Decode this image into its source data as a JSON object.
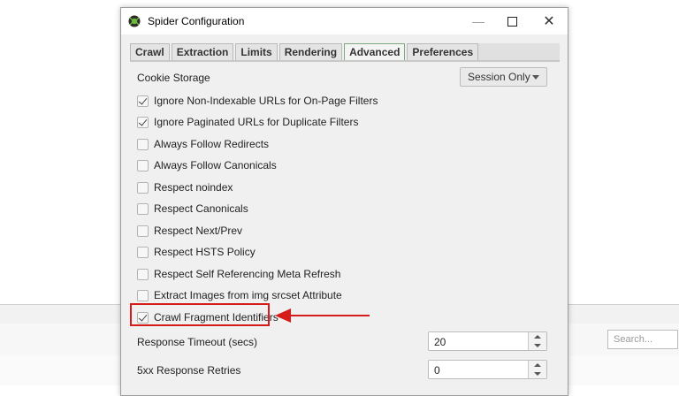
{
  "window": {
    "title": "Spider Configuration"
  },
  "tabs": [
    "Crawl",
    "Extraction",
    "Limits",
    "Rendering",
    "Advanced",
    "Preferences"
  ],
  "active_tab": "Advanced",
  "cookie_storage": {
    "label": "Cookie Storage",
    "value": "Session Only"
  },
  "options": [
    {
      "label": "Ignore Non-Indexable URLs for On-Page Filters",
      "checked": true
    },
    {
      "label": "Ignore Paginated URLs for Duplicate Filters",
      "checked": true
    },
    {
      "label": "Always Follow Redirects",
      "checked": false
    },
    {
      "label": "Always Follow Canonicals",
      "checked": false
    },
    {
      "label": "Respect noindex",
      "checked": false
    },
    {
      "label": "Respect Canonicals",
      "checked": false
    },
    {
      "label": "Respect Next/Prev",
      "checked": false
    },
    {
      "label": "Respect HSTS Policy",
      "checked": false
    },
    {
      "label": "Respect Self Referencing Meta Refresh",
      "checked": false
    },
    {
      "label": "Extract Images from img srcset Attribute",
      "checked": false
    },
    {
      "label": "Crawl Fragment Identifiers",
      "checked": true
    }
  ],
  "response_timeout": {
    "label": "Response Timeout (secs)",
    "value": "20"
  },
  "retries_5xx": {
    "label": "5xx Response Retries",
    "value": "0"
  },
  "background": {
    "search_placeholder": "Search..."
  },
  "colors": {
    "highlight": "#d71b1b",
    "active_tab_border": "#7ea87e"
  }
}
